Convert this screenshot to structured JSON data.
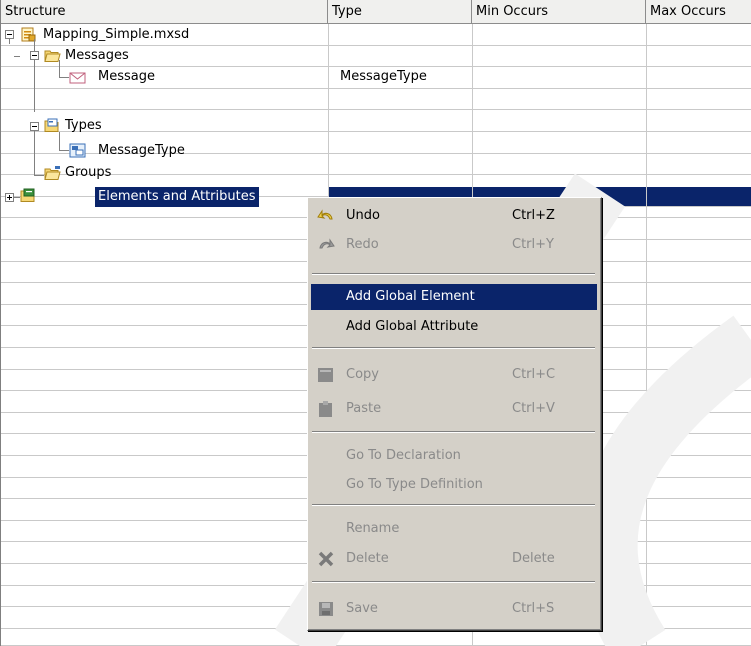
{
  "columns": [
    "Structure",
    "Type",
    "Min Occurs",
    "Max Occurs"
  ],
  "tree": {
    "root": "Mapping_Simple.mxsd",
    "messages": "Messages",
    "message": "Message",
    "message_type_value": "MessageType",
    "types": "Types",
    "message_type": "MessageType",
    "groups": "Groups",
    "elements": "Elements and Attributes"
  },
  "menu": {
    "undo": {
      "label": "Undo",
      "accel": "Ctrl+Z"
    },
    "redo": {
      "label": "Redo",
      "accel": "Ctrl+Y"
    },
    "add_element": {
      "label": "Add Global Element"
    },
    "add_attribute": {
      "label": "Add Global Attribute"
    },
    "copy": {
      "label": "Copy",
      "accel": "Ctrl+C"
    },
    "paste": {
      "label": "Paste",
      "accel": "Ctrl+V"
    },
    "goto_decl": {
      "label": "Go To Declaration"
    },
    "goto_type": {
      "label": "Go To Type Definition"
    },
    "rename": {
      "label": "Rename"
    },
    "delete": {
      "label": "Delete",
      "accel": "Delete"
    },
    "save": {
      "label": "Save",
      "accel": "Ctrl+S"
    }
  },
  "colors": {
    "selection": "#0a246a",
    "menu_bg": "#d4d0c8",
    "disabled": "#8a8a8a"
  }
}
